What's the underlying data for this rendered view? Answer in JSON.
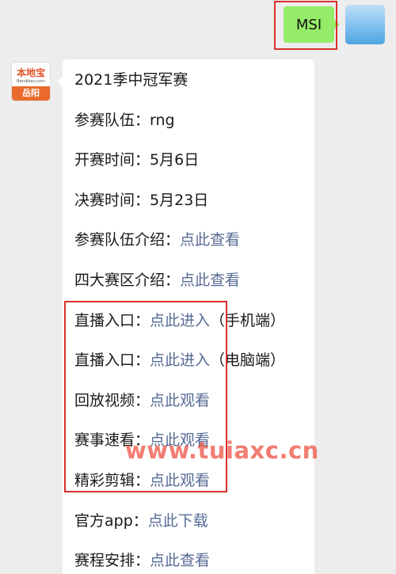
{
  "outgoing": {
    "text": "MSI"
  },
  "bot": {
    "brand": "本地宝",
    "site": "Bendibao.com",
    "city": "岳阳"
  },
  "message": {
    "title": "2021季中冠军赛",
    "items": [
      {
        "label": "参赛队伍：",
        "value": "rng"
      },
      {
        "label": "开赛时间：",
        "value": "5月6日"
      },
      {
        "label": "决赛时间：",
        "value": "5月23日"
      },
      {
        "label": "参赛队伍介绍：",
        "link": "点此查看"
      },
      {
        "label": "四大赛区介绍：",
        "link": "点此查看"
      },
      {
        "label": "直播入口：",
        "link": "点此进入",
        "suffix": "（手机端）"
      },
      {
        "label": "直播入口：",
        "link": "点此进入",
        "suffix": "（电脑端）"
      },
      {
        "label": "回放视频：",
        "link": "点此观看"
      },
      {
        "label": "赛事速看：",
        "link": "点此观看"
      },
      {
        "label": "精彩剪辑：",
        "link": "点此观看"
      },
      {
        "label": "官方app：",
        "link": "点此下载"
      },
      {
        "label": "赛程安排：",
        "link": "点此查看"
      }
    ]
  },
  "watermark": "www.tuiaxc.cn"
}
